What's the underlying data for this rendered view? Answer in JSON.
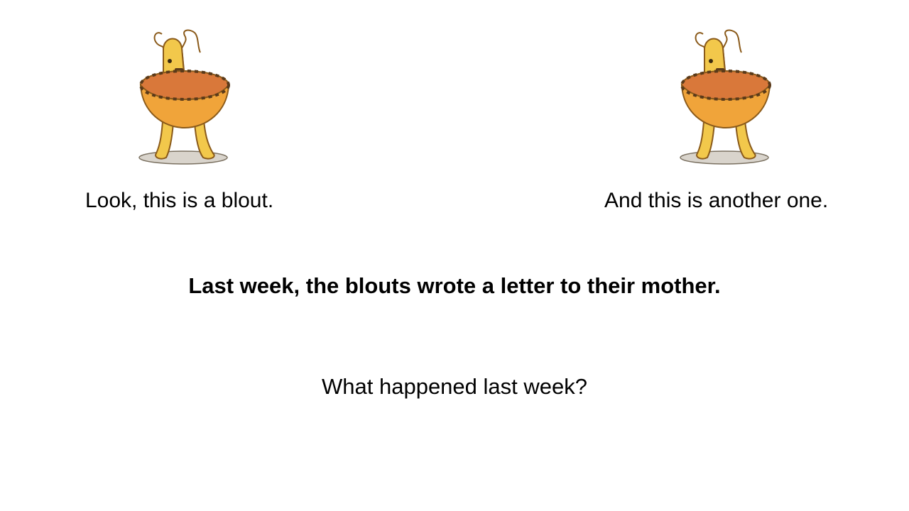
{
  "slide": {
    "left_caption": "Look, this is a blout.",
    "right_caption": "And this is another one.",
    "statement": "Last week, the blouts wrote a letter to their mother.",
    "question": "What happened  last week?"
  },
  "colors": {
    "background": "#ffffff",
    "text": "#000000",
    "creature_body": "#f2c84b",
    "bowl_outer": "#f0a43a",
    "bowl_inner": "#d9783a",
    "outline": "#8a5a1a"
  },
  "icons": {
    "left_creature": "blout-creature-illustration",
    "right_creature": "blout-creature-illustration"
  }
}
